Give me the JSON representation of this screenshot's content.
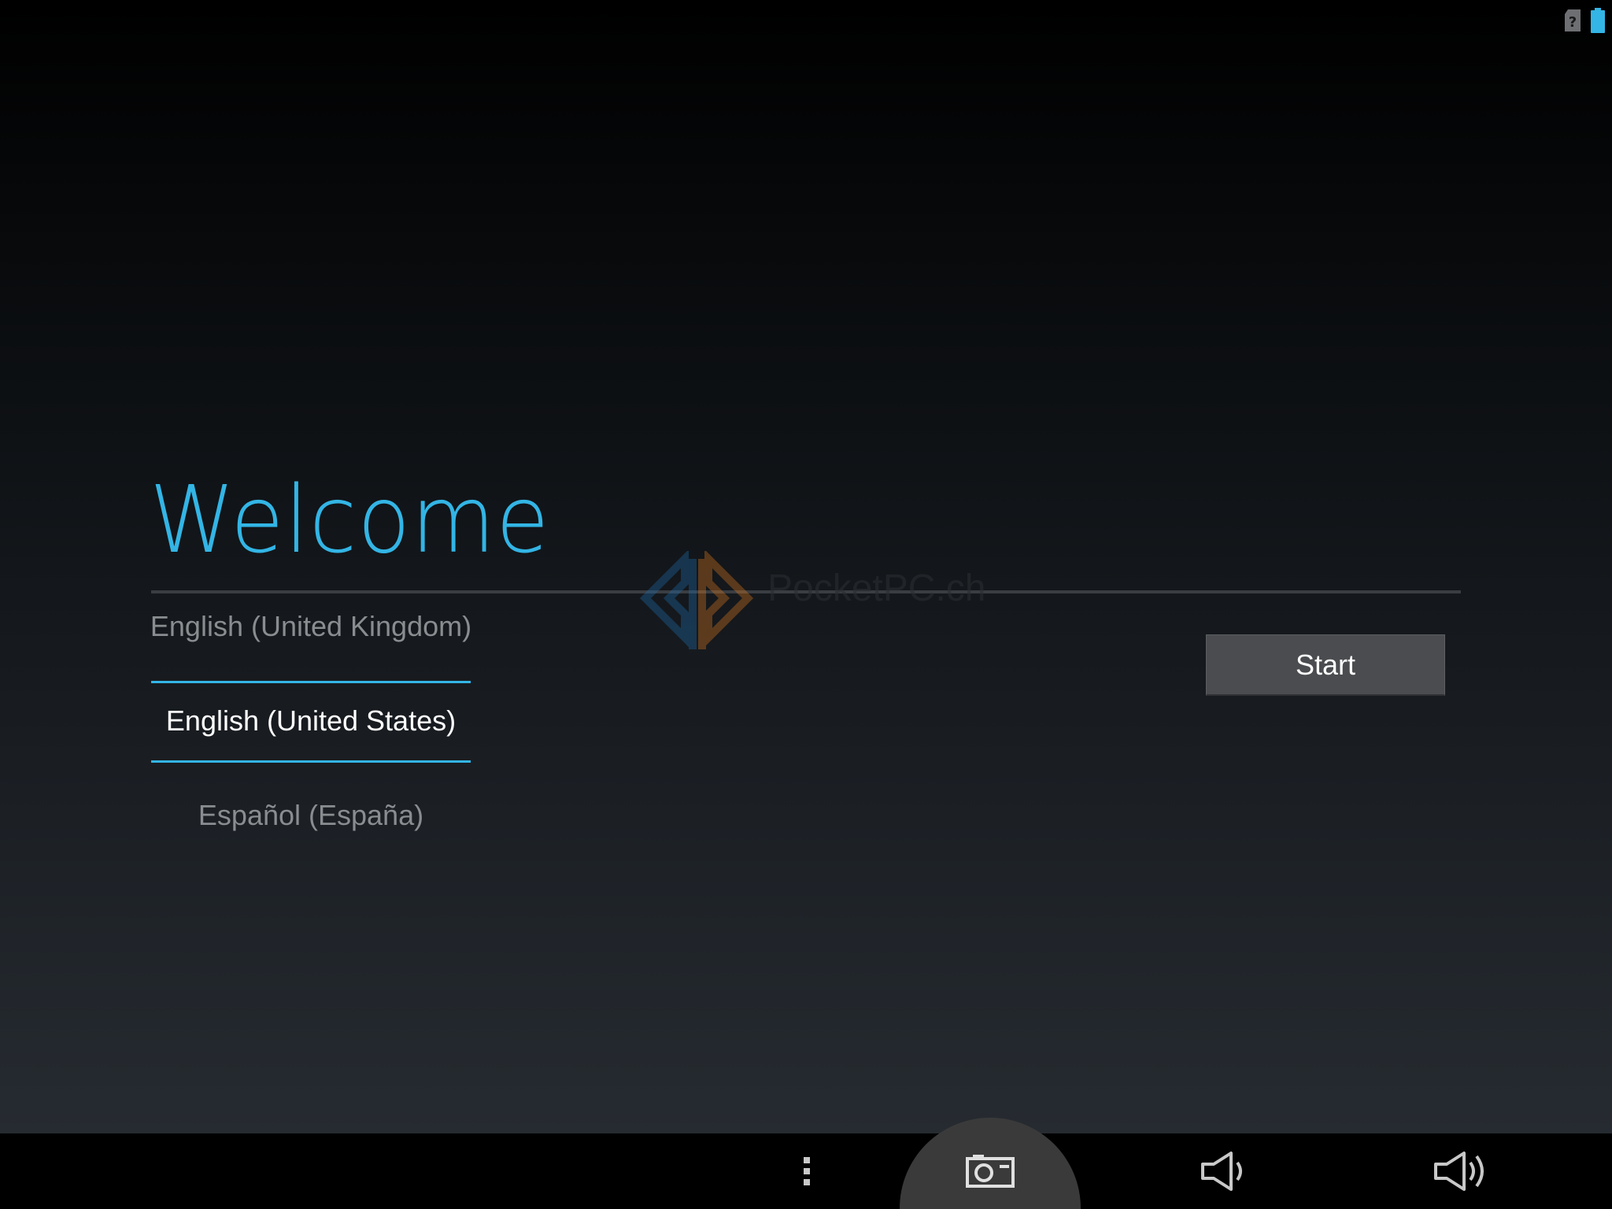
{
  "status_bar": {
    "icons": [
      "sim-unknown-icon",
      "battery-icon"
    ],
    "battery_color": "#33b5e5"
  },
  "welcome": {
    "title": "Welcome",
    "accent_color": "#33b5e5"
  },
  "language_picker": {
    "previous": "English (United Kingdom)",
    "selected": "English (United States)",
    "next": "Español (España)"
  },
  "start_button": {
    "label": "Start"
  },
  "watermark": {
    "text": "PocketPC.ch"
  },
  "nav_bar": {
    "icons": [
      "menu-dots-icon",
      "screenshot-camera-icon",
      "volume-down-icon",
      "volume-up-icon"
    ]
  }
}
